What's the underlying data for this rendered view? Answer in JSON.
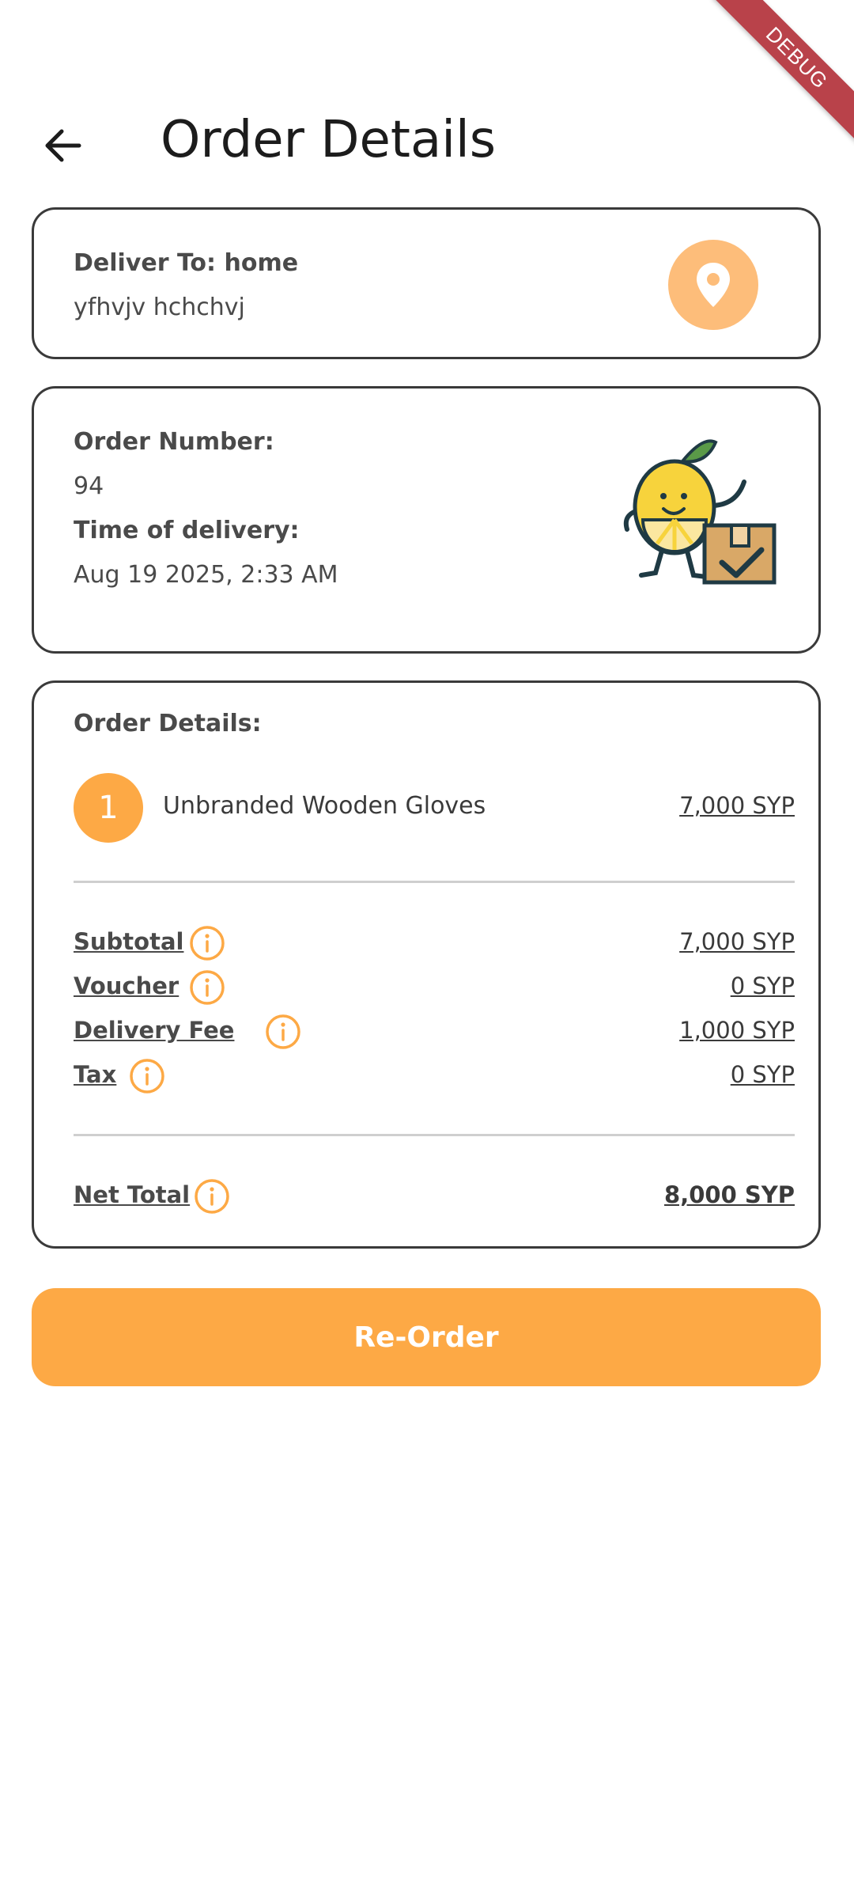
{
  "debug_banner": "DEBUG",
  "header": {
    "title": "Order Details"
  },
  "delivery": {
    "label": "Deliver To: home",
    "address": "yfhvjv  hchchvj"
  },
  "order_info": {
    "number_label": "Order Number:",
    "number_value": "94",
    "time_label": "Time of delivery:",
    "time_value": "Aug 19 2025, 2:33 AM"
  },
  "details": {
    "heading": "Order Details:",
    "items": [
      {
        "qty": "1",
        "name": "Unbranded Wooden Gloves",
        "price": "7,000 SYP"
      }
    ],
    "summary": [
      {
        "label": "Subtotal",
        "value": "7,000 SYP"
      },
      {
        "label": "Voucher",
        "value": "0 SYP"
      },
      {
        "label": "Delivery Fee",
        "value": "1,000 SYP"
      },
      {
        "label": "Tax",
        "value": "0 SYP"
      }
    ],
    "net_total": {
      "label": "Net Total",
      "value": "8,000 SYP"
    }
  },
  "reorder_button": "Re-Order",
  "colors": {
    "accent": "#fda945",
    "pin_bg": "#fdbd7a",
    "border": "#3a3a3a",
    "debug": "#b9424a"
  },
  "icons": {
    "back": "arrow-left-icon",
    "pin": "location-pin-icon",
    "info": "info-icon",
    "mascot": "lemon-mascot-with-box"
  }
}
